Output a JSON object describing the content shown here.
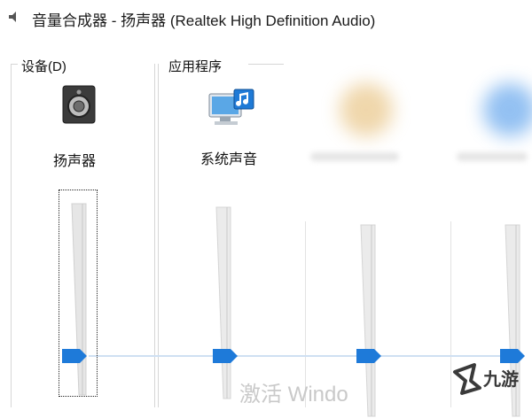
{
  "window": {
    "title": "音量合成器 - 扬声器 (Realtek High Definition Audio)",
    "icon": "speaker-icon"
  },
  "sections": {
    "device_label": "设备(D)",
    "apps_label": "应用程序"
  },
  "device": {
    "name": "扬声器",
    "icon": "speaker-device-icon"
  },
  "apps": [
    {
      "name": "系统声音",
      "icon": "system-sounds-icon"
    }
  ],
  "watermark": "激活 Windo",
  "brand": {
    "text": "九游",
    "icon": "jiuyou-logo-icon"
  },
  "colors": {
    "thumb": "#1e7ad9",
    "connector": "#cfe0f2",
    "track": "#e8e8e8"
  }
}
